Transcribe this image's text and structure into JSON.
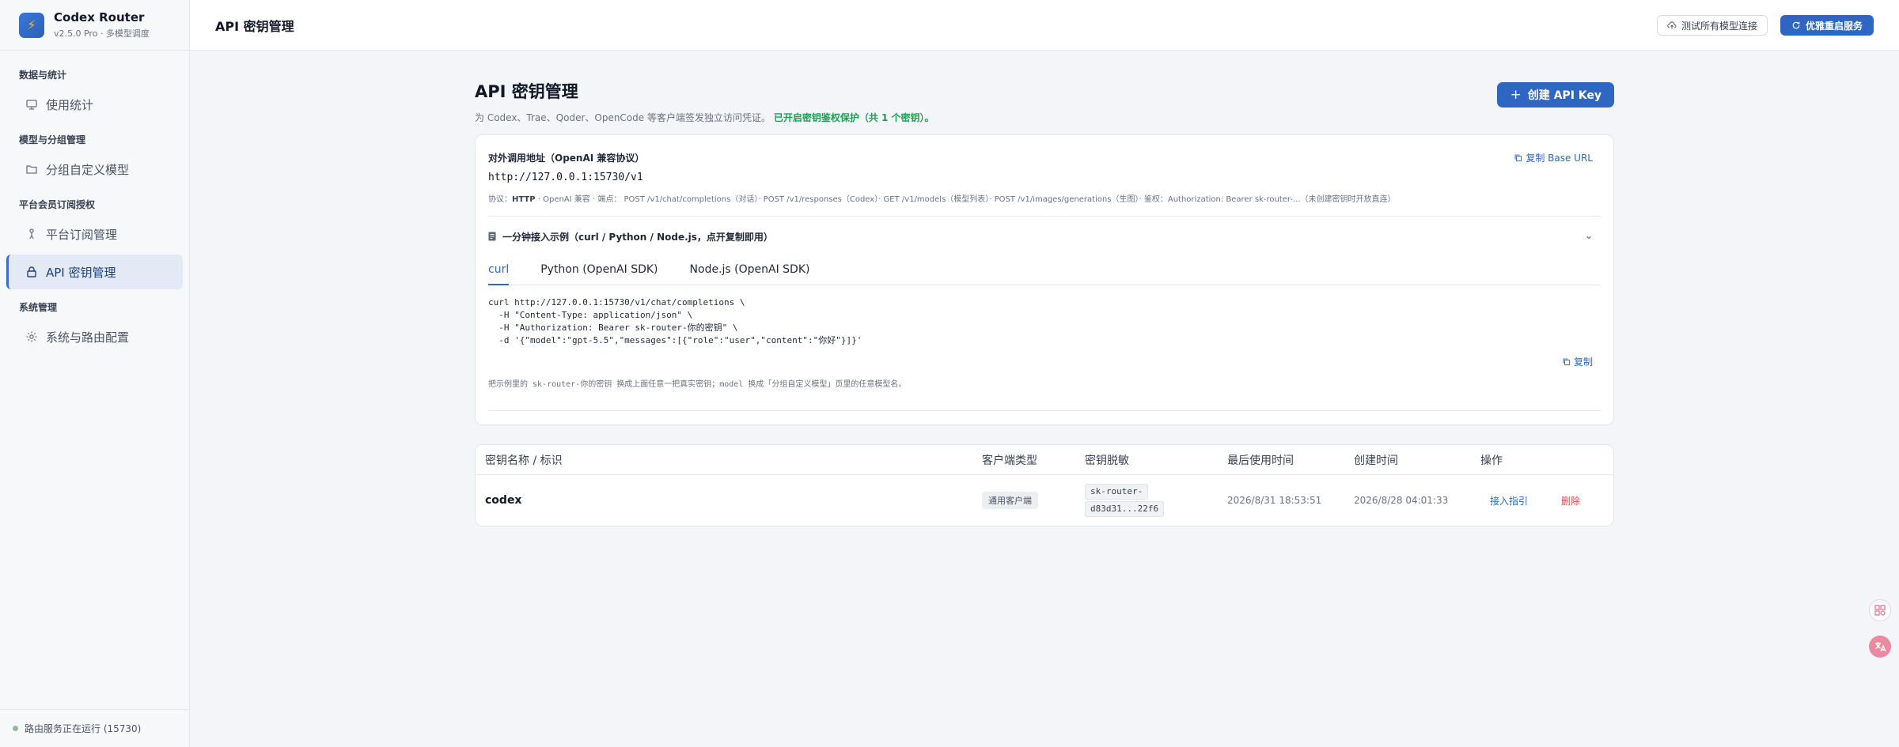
{
  "brand": {
    "name": "Codex Router",
    "sub": "v2.5.0 Pro · 多模型调度"
  },
  "sidebar": {
    "groups": [
      {
        "label": "数据与统计",
        "items": [
          {
            "label": "使用统计",
            "icon": "chart-icon"
          }
        ]
      },
      {
        "label": "模型与分组管理",
        "items": [
          {
            "label": "分组自定义模型",
            "icon": "folder-icon"
          }
        ]
      },
      {
        "label": "平台会员订阅授权",
        "items": [
          {
            "label": "平台订阅管理",
            "icon": "person-icon"
          },
          {
            "label": "API 密钥管理",
            "icon": "lock-icon",
            "active": true
          }
        ]
      },
      {
        "label": "系统管理",
        "items": [
          {
            "label": "系统与路由配置",
            "icon": "gear-icon"
          }
        ]
      }
    ],
    "footer": "路由服务正在运行 (15730)"
  },
  "topbar": {
    "title": "API 密钥管理",
    "test_btn": "测试所有模型连接",
    "restart_btn": "优雅重启服务"
  },
  "page": {
    "title": "API 密钥管理",
    "desc": "为 Codex、Trae、Qoder、OpenCode 等客户端签发独立访问凭证。",
    "desc_ok": "已开启密钥鉴权保护（共 1 个密钥）。",
    "create_btn": "创建 API Key"
  },
  "endpoint": {
    "label": "对外调用地址（OpenAI 兼容协议）",
    "copy_base": "复制 Base URL",
    "url": "http://127.0.0.1:15730/v1",
    "proto_prefix": "协议：",
    "proto_http": "HTTP",
    "proto_rest": " · OpenAI 兼容 · 端点： POST /v1/chat/completions（对话）· POST /v1/responses（Codex）· GET /v1/models（模型列表）· POST /v1/images/generations（生图）· 鉴权：Authorization: Bearer sk-router-...（未创建密钥时开放直连）",
    "accordion": "一分钟接入示例（curl / Python / Node.js，点开复制即用）",
    "tabs": [
      "curl",
      "Python (OpenAI SDK)",
      "Node.js (OpenAI SDK)"
    ],
    "code": "curl http://127.0.0.1:15730/v1/chat/completions \\\n  -H \"Content-Type: application/json\" \\\n  -H \"Authorization: Bearer sk-router-你的密钥\" \\\n  -d '{\"model\":\"gpt-5.5\",\"messages\":[{\"role\":\"user\",\"content\":\"你好\"}]}'",
    "copy": "复制",
    "hint": "把示例里的 sk-router-你的密钥 换成上面任意一把真实密钥；model 换成「分组自定义模型」页里的任意模型名。"
  },
  "table": {
    "headers": [
      "密钥名称 / 标识",
      "客户端类型",
      "密钥脱敏",
      "最后使用时间",
      "创建时间",
      "操作"
    ],
    "rows": [
      {
        "name": "codex",
        "client": "通用客户端",
        "mask1": "sk-router-",
        "mask2": "d83d31...22f6",
        "last_used": "2026/8/31 18:53:51",
        "created": "2026/8/28 04:01:33",
        "guide": "接入指引",
        "delete": "删除"
      }
    ]
  },
  "colors": {
    "accent": "#2f66c4",
    "success": "#1f9d55",
    "danger": "#d94a4a"
  }
}
